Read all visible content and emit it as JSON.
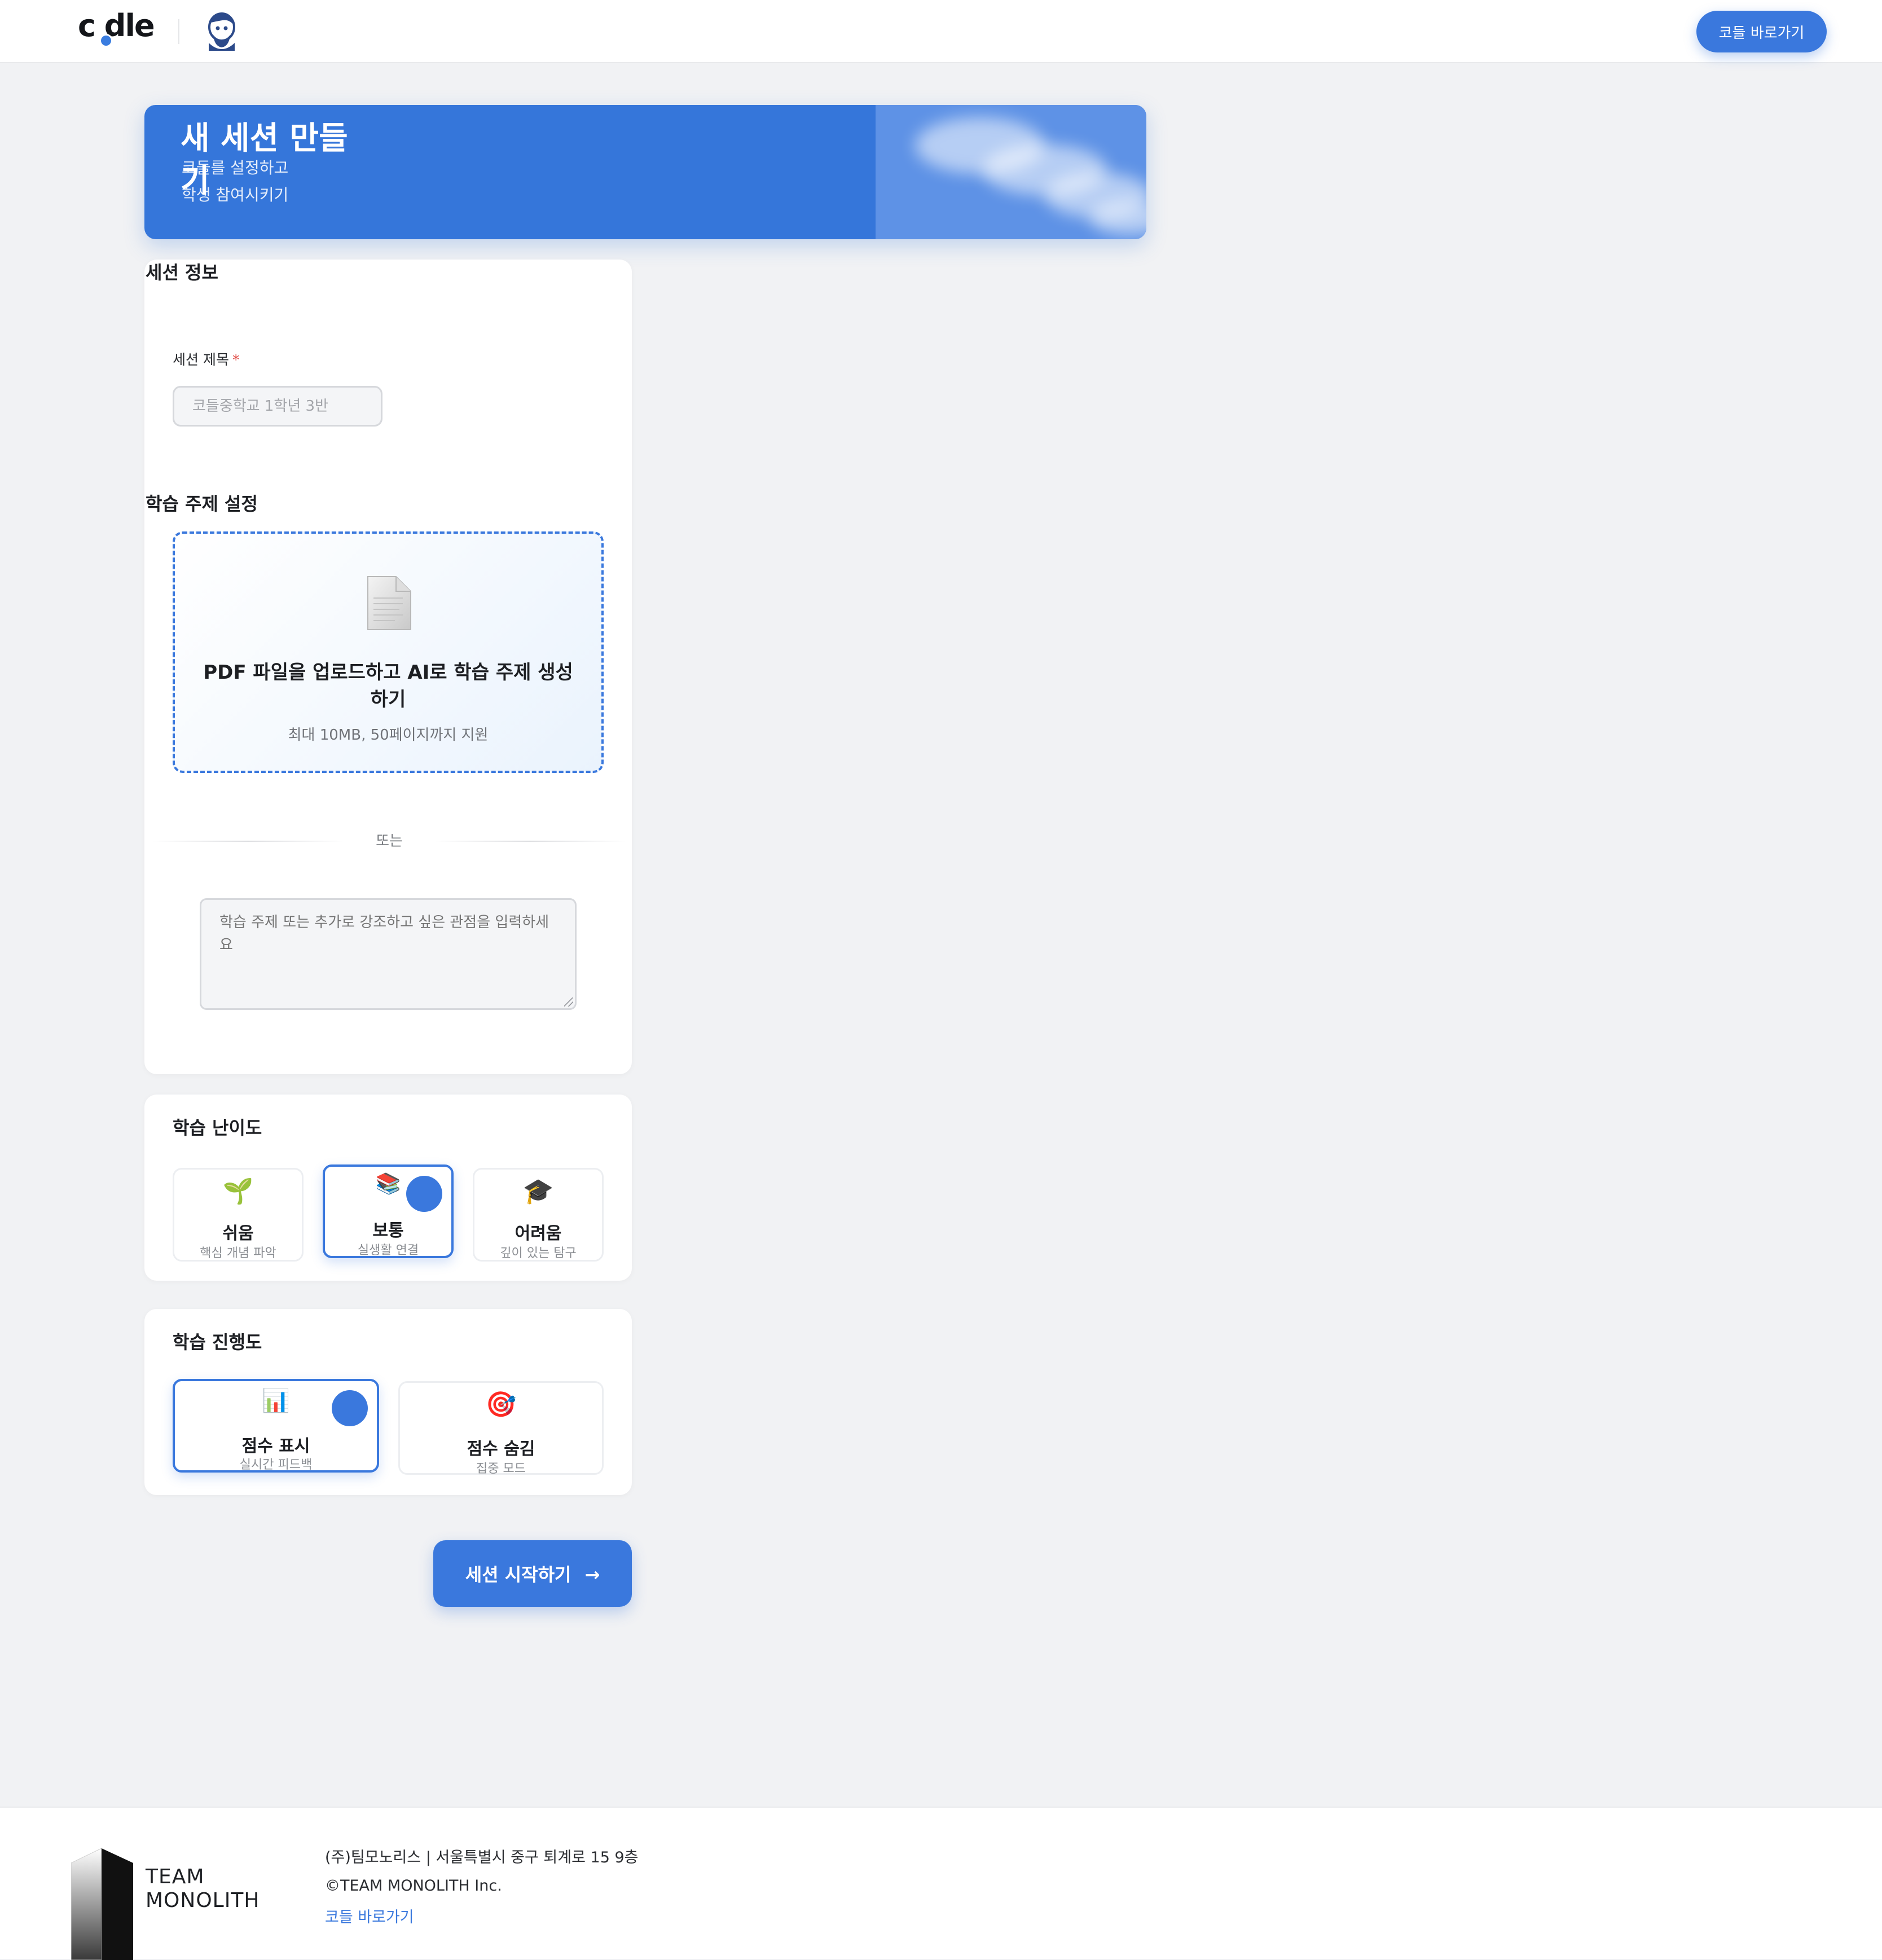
{
  "header": {
    "logo_text": "c dle",
    "go_button": "코들 바로가기"
  },
  "hero": {
    "title": "새 세션 만들기",
    "subtitle": "코들를 설정하고 학생 참여시키기"
  },
  "session_info": {
    "heading": "세션 정보",
    "title_label": "세션 제목",
    "required_mark": "*",
    "title_placeholder": "코들중학교 1학년 3반"
  },
  "topic": {
    "heading": "학습 주제 설정",
    "upload_title": "PDF 파일을 업로드하고 AI로 학습 주제 생성하기",
    "upload_sub": "최대 10MB, 50페이지까지 지원",
    "or_text": "또는",
    "textarea_placeholder": "학습 주제 또는 추가로 강조하고 싶은 관점을 입력하세요"
  },
  "difficulty": {
    "heading": "학습 난이도",
    "options": [
      {
        "emoji": "🌱",
        "label": "쉬움",
        "desc": "핵심 개념 파악",
        "selected": false
      },
      {
        "emoji": "📚",
        "label": "보통",
        "desc": "실생활 연결",
        "selected": true
      },
      {
        "emoji": "🎓",
        "label": "어려움",
        "desc": "깊이 있는 탐구",
        "selected": false
      }
    ]
  },
  "progress": {
    "heading": "학습 진행도",
    "options": [
      {
        "emoji": "📊",
        "label": "점수 표시",
        "desc": "실시간 피드백",
        "selected": true
      },
      {
        "emoji": "🎯",
        "label": "점수 숨김",
        "desc": "집중 모드",
        "selected": false
      }
    ]
  },
  "start_button": "세션 시작하기",
  "footer": {
    "brand_line1": "TEAM",
    "brand_line2": "MONOLITH",
    "company": "(주)팀모노리스 | 서울특별시 중구 퇴계로 15 9층",
    "copyright": "©TEAM MONOLITH Inc.",
    "link": "코들 바로가기"
  },
  "colors": {
    "accent": "#3a78dd",
    "hero": "#3576da",
    "background": "#f1f2f4"
  }
}
